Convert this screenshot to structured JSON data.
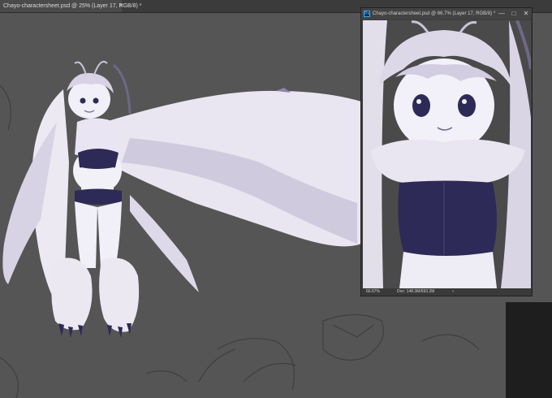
{
  "document_tab": {
    "title": "Chayo-charactersheet.psd @ 25% (Layer 17, RGB/8) *",
    "close_glyph": "×"
  },
  "floating_window": {
    "title": "Chayo-charactersheet.psd @ 66.7% (Layer 17, RGB/8) *",
    "app_icon_label": "Ps",
    "minimize_glyph": "—",
    "maximize_glyph": "□",
    "close_glyph": "✕",
    "status": {
      "zoom": "66.67%",
      "doc_info": "Doc: 148.3M/693.2M",
      "arrow_glyph": "›"
    }
  },
  "colors": {
    "canvas_bg": "#555555",
    "character_light": "#f0eef6",
    "character_shadow": "#b9b2cf",
    "outfit_dark": "#2d2a57",
    "ps_icon_accent": "#3aa6f0"
  }
}
